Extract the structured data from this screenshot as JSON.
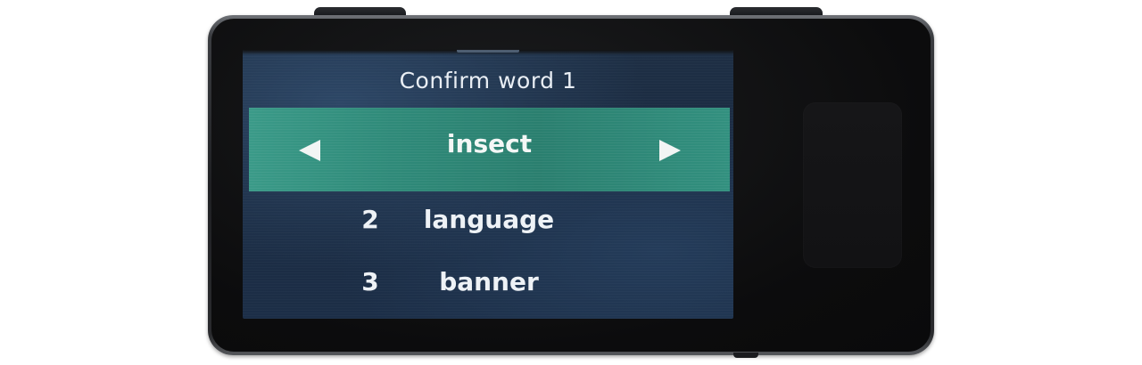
{
  "screen": {
    "title": "Confirm word 1",
    "selected": {
      "word": "insect",
      "left_arrow_icon": "triangle-left-icon",
      "right_arrow_icon": "triangle-right-icon"
    },
    "options": [
      {
        "number": "2",
        "word": "language"
      },
      {
        "number": "3",
        "word": "banner"
      }
    ]
  },
  "colors": {
    "screen_background": "#1c2d44",
    "selection_highlight": "#2f8a79",
    "text": "#eef2f6",
    "device_body": "#0c0c0d"
  }
}
